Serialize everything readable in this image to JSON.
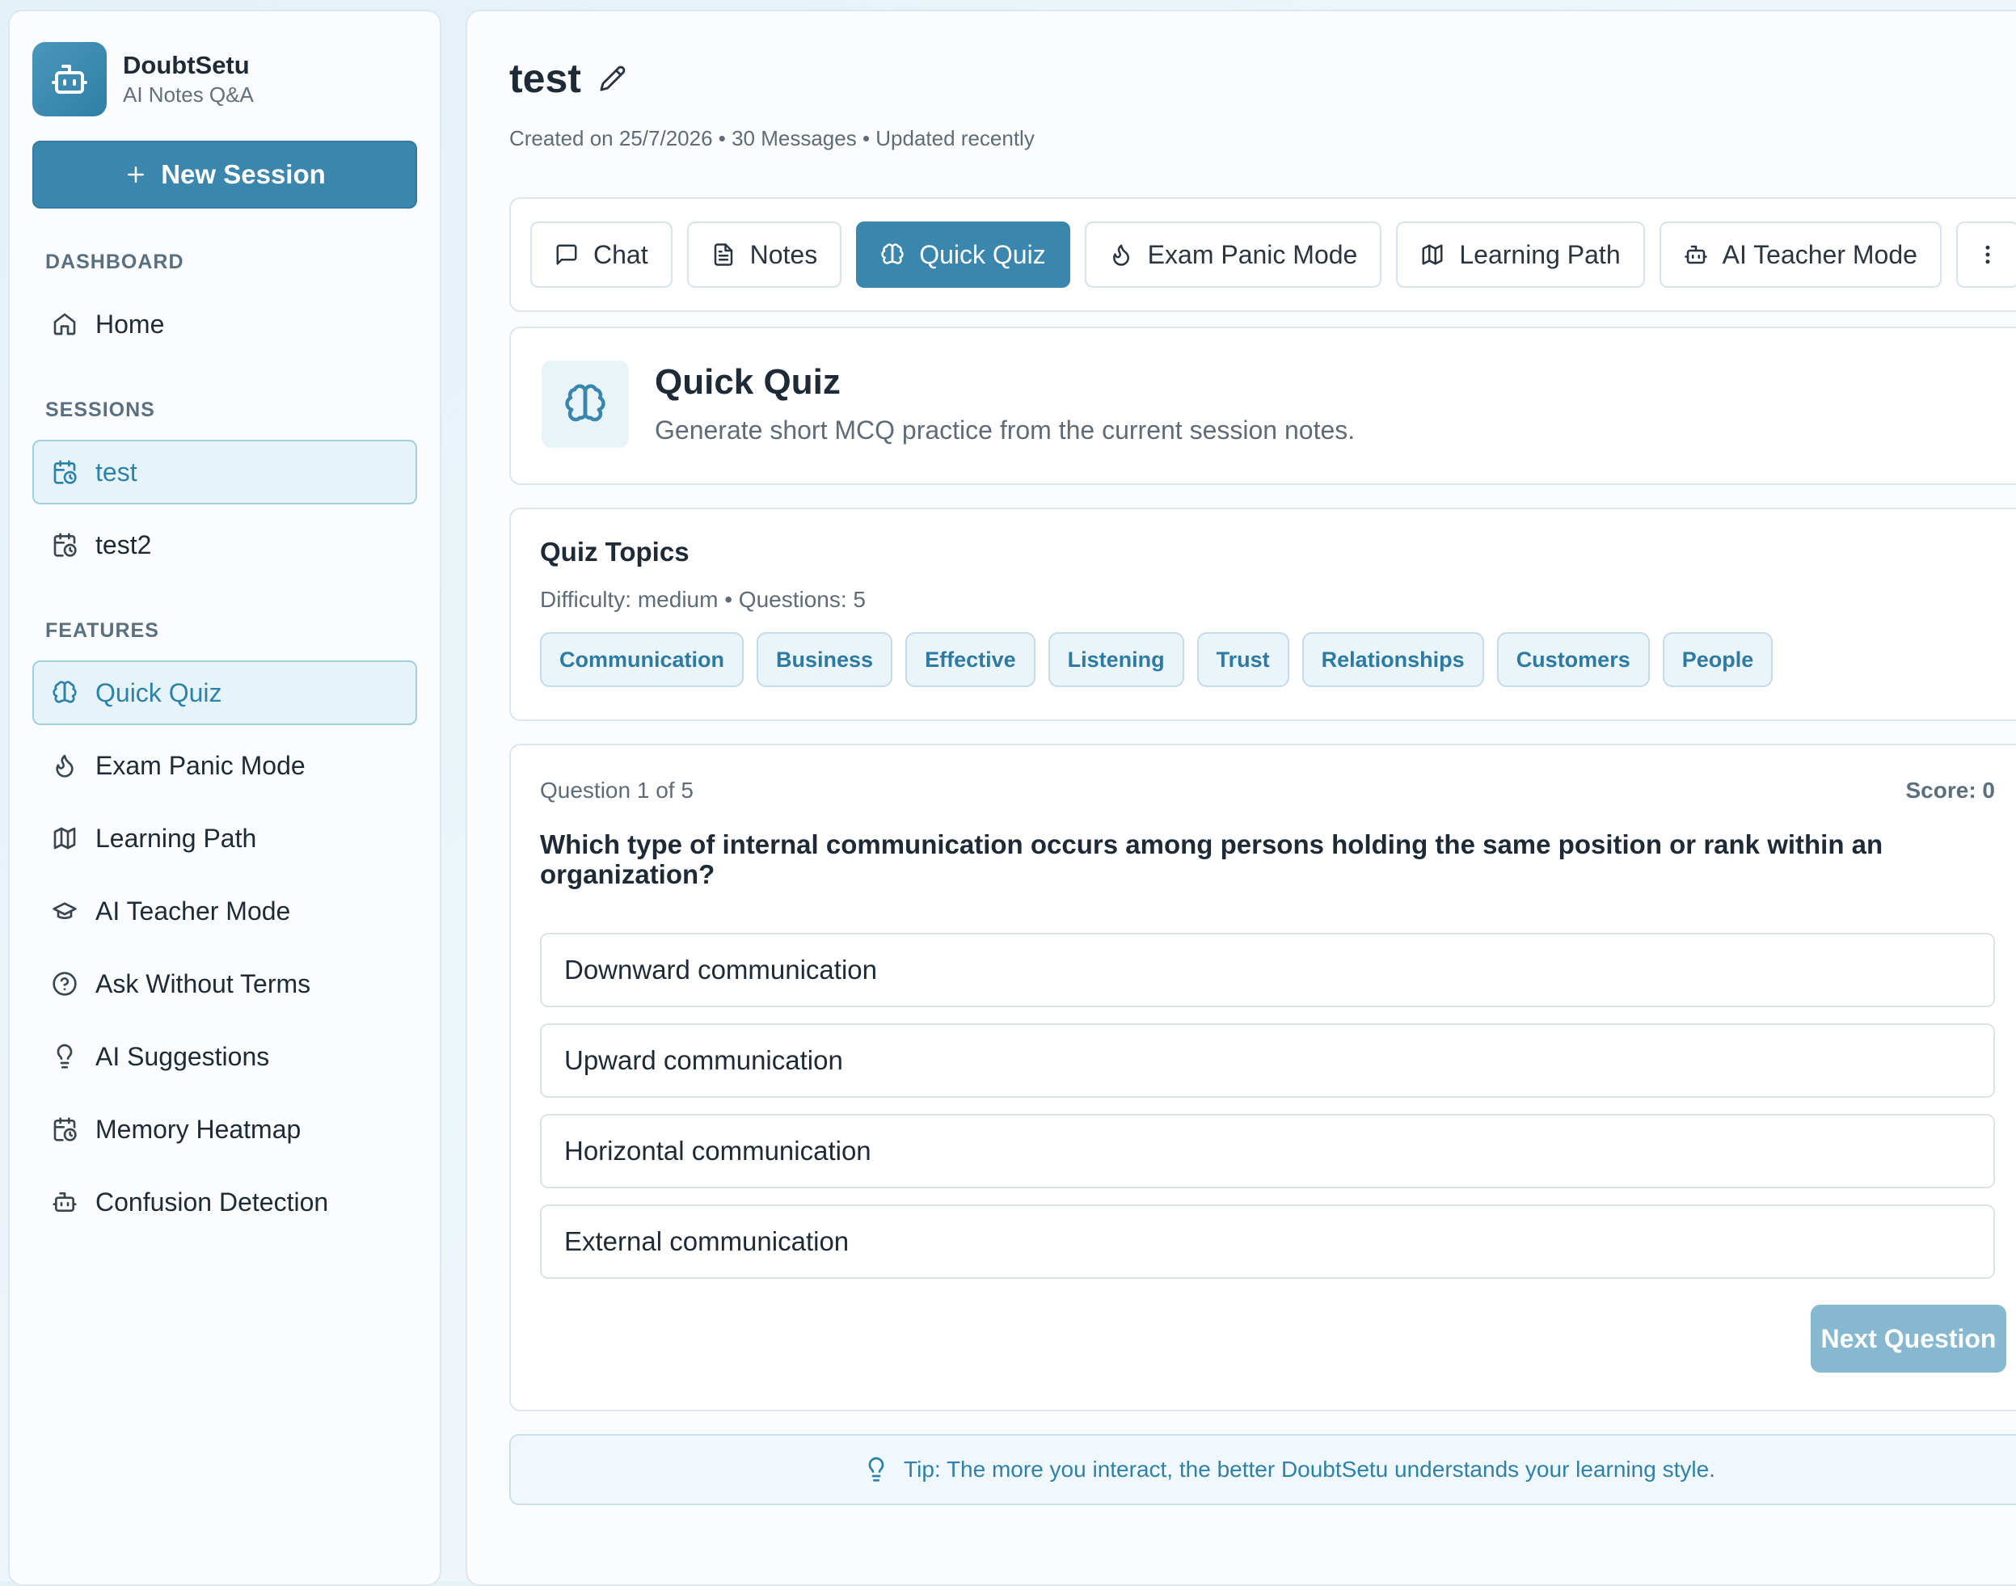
{
  "brand": {
    "name": "DoubtSetu",
    "subtitle": "AI Notes Q&A",
    "logo_icon": "robot-icon"
  },
  "sidebar": {
    "new_session_label": "New Session",
    "sections": {
      "dashboard": "DASHBOARD",
      "sessions": "SESSIONS",
      "features": "FEATURES"
    },
    "dashboard_items": [
      {
        "label": "Home",
        "icon": "home-icon"
      }
    ],
    "session_items": [
      {
        "label": "test",
        "icon": "calendar-clock-icon",
        "active": true
      },
      {
        "label": "test2",
        "icon": "calendar-clock-icon",
        "active": false
      }
    ],
    "feature_items": [
      {
        "label": "Quick Quiz",
        "icon": "brain-icon",
        "active": true
      },
      {
        "label": "Exam Panic Mode",
        "icon": "flame-icon"
      },
      {
        "label": "Learning Path",
        "icon": "map-icon"
      },
      {
        "label": "AI Teacher Mode",
        "icon": "graduation-cap-icon"
      },
      {
        "label": "Ask Without Terms",
        "icon": "help-circle-icon"
      },
      {
        "label": "AI Suggestions",
        "icon": "lightbulb-icon"
      },
      {
        "label": "Memory Heatmap",
        "icon": "calendar-clock-icon"
      },
      {
        "label": "Confusion Detection",
        "icon": "robot-icon"
      }
    ]
  },
  "page": {
    "title": "test",
    "meta": "Created on 25/7/2026 • 30 Messages • Updated recently"
  },
  "tabs": [
    {
      "label": "Chat",
      "icon": "message-square-icon"
    },
    {
      "label": "Notes",
      "icon": "file-text-icon"
    },
    {
      "label": "Quick Quiz",
      "icon": "brain-icon",
      "active": true
    },
    {
      "label": "Exam Panic Mode",
      "icon": "flame-icon"
    },
    {
      "label": "Learning Path",
      "icon": "map-icon"
    },
    {
      "label": "AI Teacher Mode",
      "icon": "robot-icon"
    }
  ],
  "quiz_header": {
    "title": "Quick Quiz",
    "subtitle": "Generate short MCQ practice from the current session notes."
  },
  "topics": {
    "title": "Quiz Topics",
    "meta": "Difficulty: medium • Questions: 5",
    "chips": [
      "Communication",
      "Business",
      "Effective",
      "Listening",
      "Trust",
      "Relationships",
      "Customers",
      "People"
    ]
  },
  "question": {
    "progress": "Question 1 of 5",
    "score": "Score: 0",
    "text": "Which type of internal communication occurs among persons holding the same position or rank within an organization?",
    "options": [
      "Downward communication",
      "Upward communication",
      "Horizontal communication",
      "External communication"
    ],
    "next_label": "Next Question"
  },
  "tip": "Tip: The more you interact, the better DoubtSetu understands your learning style.",
  "colors": {
    "accent": "#3a86ad",
    "accent_light": "#e6f4f9",
    "disabled_button": "#86b8cf"
  }
}
